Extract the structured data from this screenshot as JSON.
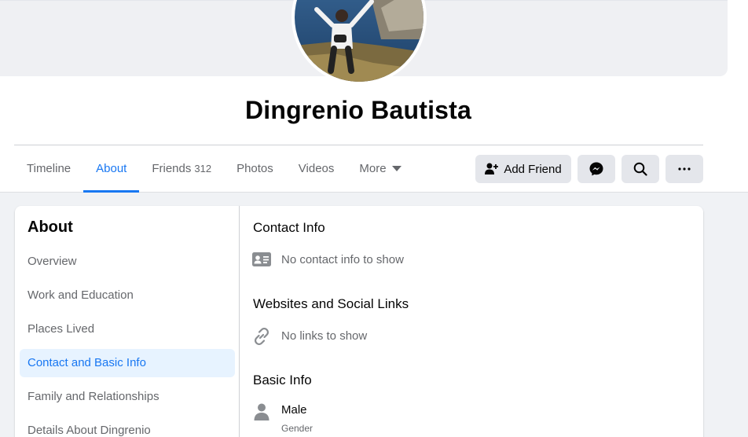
{
  "profile": {
    "name": "Dingrenio Bautista"
  },
  "tabs": [
    {
      "label": "Timeline"
    },
    {
      "label": "About"
    },
    {
      "label": "Friends",
      "count": "312"
    },
    {
      "label": "Photos"
    },
    {
      "label": "Videos"
    },
    {
      "label": "More"
    }
  ],
  "actions": {
    "add_friend": "Add Friend",
    "messenger_icon": "messenger-icon",
    "search_icon": "search-icon",
    "more_icon": "ellipsis-icon"
  },
  "about": {
    "title": "About",
    "nav": [
      {
        "label": "Overview"
      },
      {
        "label": "Work and Education"
      },
      {
        "label": "Places Lived"
      },
      {
        "label": "Contact and Basic Info",
        "active": true
      },
      {
        "label": "Family and Relationships"
      },
      {
        "label": "Details About Dingrenio"
      }
    ]
  },
  "content": {
    "contact": {
      "heading": "Contact Info",
      "text": "No contact info to show"
    },
    "websites": {
      "heading": "Websites and Social Links",
      "text": "No links to show"
    },
    "basic": {
      "heading": "Basic Info",
      "value": "Male",
      "label": "Gender"
    }
  },
  "colors": {
    "accent": "#1877f2",
    "active_bg": "#e7f3ff",
    "button_bg": "#e4e6eb",
    "secondary_text": "#65676b"
  }
}
